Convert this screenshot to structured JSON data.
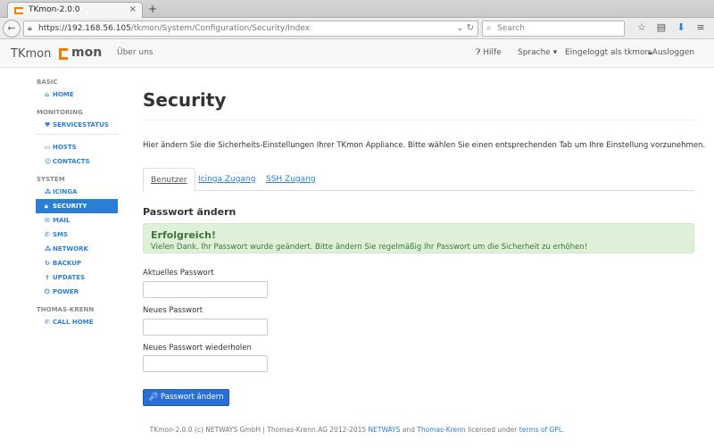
{
  "browser": {
    "tab_title": "TKmon-2.0.0",
    "tab_close": "×",
    "new_tab": "+",
    "back": "←",
    "url_host": "https://192.168.56.105",
    "url_path": "/tkmon/System/Configuration/Security/Index",
    "url_icons": "⌄ ↻",
    "search_placeholder": "Search",
    "icons": [
      "star-icon",
      "reader-icon",
      "download-icon",
      "menu-icon"
    ]
  },
  "header": {
    "brand": "TKmon",
    "logo_text": "mon",
    "about": "Über uns",
    "help": "Hilfe",
    "language": "Sprache",
    "logged_in": "Eingeloggt als tkmon",
    "logout": "Ausloggen"
  },
  "sidebar": {
    "sections": [
      {
        "heading": "Basic",
        "items": [
          {
            "label": "Home",
            "icon": "home-icon"
          }
        ]
      },
      {
        "heading": "Monitoring",
        "items": [
          {
            "label": "Servicestatus",
            "icon": "heart-icon"
          }
        ]
      },
      {
        "heading": "",
        "items": [
          {
            "label": "Hosts",
            "icon": "monitor-icon"
          },
          {
            "label": "Contacts",
            "icon": "user-icon"
          }
        ]
      },
      {
        "heading": "System",
        "items": [
          {
            "label": "Icinga",
            "icon": "icinga-icon"
          },
          {
            "label": "Security",
            "icon": "lock-icon",
            "active": true
          },
          {
            "label": "Mail",
            "icon": "mail-icon"
          },
          {
            "label": "SMS",
            "icon": "phone-icon"
          },
          {
            "label": "Network",
            "icon": "network-icon"
          },
          {
            "label": "Backup",
            "icon": "refresh-icon"
          },
          {
            "label": "Updates",
            "icon": "upload-icon"
          },
          {
            "label": "Power",
            "icon": "power-icon"
          }
        ]
      },
      {
        "heading": "Thomas-Krenn",
        "items": [
          {
            "label": "Call Home",
            "icon": "phone-icon"
          }
        ]
      }
    ]
  },
  "main": {
    "title": "Security",
    "intro": "Hier ändern Sie die Sicherheits-Einstellungen Ihrer TKmon Appliance. Bitte wählen Sie einen entsprechenden Tab um Ihre Einstellung vorzunehmen.",
    "tabs": [
      {
        "label": "Benutzer",
        "active": true
      },
      {
        "label": "Icinga Zugang",
        "active": false
      },
      {
        "label": "SSH Zugang",
        "active": false
      }
    ],
    "section_title": "Passwort ändern",
    "alert": {
      "title": "Erfolgreich!",
      "text": "Vielen Dank. Ihr Passwort wurde geändert. Bitte ändern Sie regelmäßig Ihr Passwort um die Sicherheit zu erhöhen!"
    },
    "fields": [
      {
        "label": "Aktuelles Passwort",
        "value": ""
      },
      {
        "label": "Neues Passwort",
        "value": ""
      },
      {
        "label": "Neues Passwort wiederholen",
        "value": ""
      }
    ],
    "submit": "Passwort ändern"
  },
  "footer": {
    "prefix": "TKmon-2.0.0 (c) NETWAYS GmbH | Thomas-Krenn.AG 2012-2015",
    "netways": "NETWAYS",
    "and": "and",
    "tk": "Thomas-Krenn",
    "licensed": "licensed under",
    "terms": "terms of GPL",
    "suffix": "."
  },
  "colors": {
    "accent": "#2a7fd4",
    "logo": "#f57c00",
    "success_bg": "#dff0d8",
    "success_text": "#3c763d"
  }
}
